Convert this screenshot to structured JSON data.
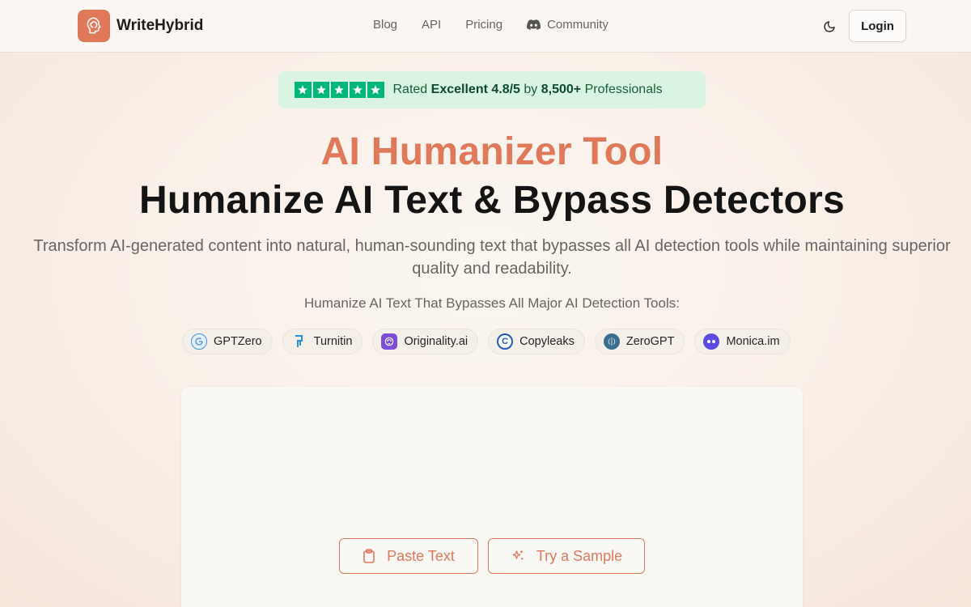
{
  "header": {
    "brand_name": "WriteHybrid",
    "nav": [
      "Blog",
      "API",
      "Pricing",
      "Community"
    ],
    "login_label": "Login"
  },
  "rating": {
    "prefix": "Rated",
    "quality": "Excellent 4.8/5",
    "by": "by",
    "count": "8,500+",
    "suffix": "Professionals",
    "stars": 5
  },
  "hero": {
    "accent_title": "AI Humanizer Tool",
    "main_title": "Humanize AI Text & Bypass Detectors",
    "subtitle": "Transform AI-generated content into natural, human-sounding text that bypasses all AI detection tools while maintaining superior quality and readability.",
    "tools_heading": "Humanize AI Text That Bypasses All Major AI Detection Tools:"
  },
  "tools": [
    {
      "name": "GPTZero",
      "icon": "gptzero-icon",
      "color": "#4a90e2"
    },
    {
      "name": "Turnitin",
      "icon": "turnitin-icon",
      "color": "#2b8fd6"
    },
    {
      "name": "Originality.ai",
      "icon": "originality-icon",
      "color": "#7c4dd8"
    },
    {
      "name": "Copyleaks",
      "icon": "copyleaks-icon",
      "color": "#1e5fb3"
    },
    {
      "name": "ZeroGPT",
      "icon": "zerogpt-icon",
      "color": "#3b6d8c"
    },
    {
      "name": "Monica.im",
      "icon": "monica-icon",
      "color": "#5b4be0"
    }
  ],
  "editor": {
    "paste_label": "Paste Text",
    "sample_label": "Try a Sample"
  },
  "colors": {
    "accent": "#e0785a",
    "star_green": "#00b67a",
    "badge_bg": "#d9f5e1"
  }
}
